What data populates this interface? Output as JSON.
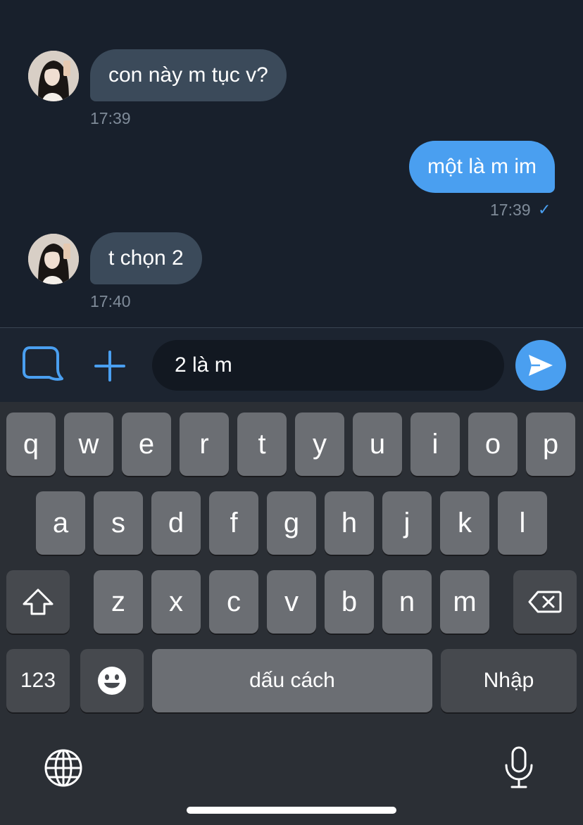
{
  "messages": [
    {
      "direction": "incoming",
      "text": "con này m tục v?",
      "time": "17:39"
    },
    {
      "direction": "outgoing",
      "text": "một là m im",
      "time": "17:39",
      "status": "✓"
    },
    {
      "direction": "incoming",
      "text": "t chọn 2",
      "time": "17:40"
    }
  ],
  "composer": {
    "input_value": "2 là m",
    "sticker_icon": "sticker-icon",
    "attach_icon": "plus-icon",
    "send_icon": "send-icon"
  },
  "keyboard": {
    "row1": [
      "q",
      "w",
      "e",
      "r",
      "t",
      "y",
      "u",
      "i",
      "o",
      "p"
    ],
    "row2": [
      "a",
      "s",
      "d",
      "f",
      "g",
      "h",
      "j",
      "k",
      "l"
    ],
    "row3": [
      "z",
      "x",
      "c",
      "v",
      "b",
      "n",
      "m"
    ],
    "numbers_label": "123",
    "space_label": "dấu cách",
    "return_label": "Nhập",
    "shift_icon": "shift-icon",
    "backspace_icon": "backspace-icon",
    "emoji_icon": "emoji-icon",
    "globe_icon": "globe-icon",
    "mic_icon": "microphone-icon"
  },
  "colors": {
    "background": "#18202c",
    "incoming_bubble": "#3b4a5a",
    "outgoing_bubble": "#4a9ff0",
    "accent": "#4a9ff0",
    "key": "#6b6e73",
    "key_dark": "#46494e"
  }
}
